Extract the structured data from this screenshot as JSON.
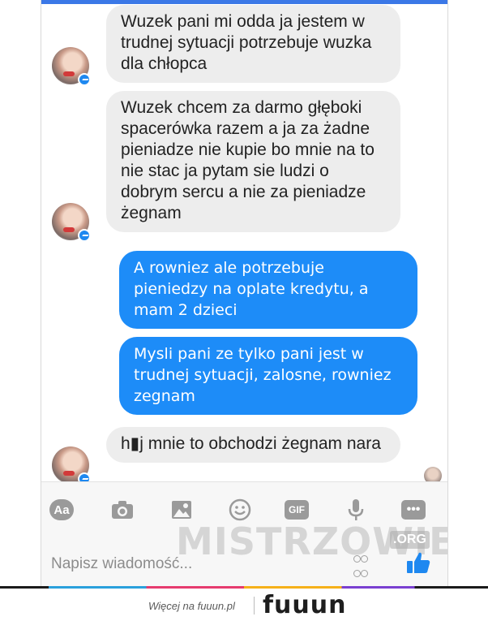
{
  "messages": [
    {
      "direction": "incoming",
      "text": "Wuzek pani mi odda ja jestem w trudnej sytuacji potrzebuje wuzka dla chłopca"
    },
    {
      "direction": "incoming",
      "text": "Wuzek chcem za darmo głęboki spacerówka razem a ja za żadne pieniadze nie kupie bo mnie na to nie stac ja pytam sie ludzi o dobrym sercu a nie za pieniadze żegnam"
    },
    {
      "direction": "outgoing",
      "text": "A rowniez ale potrzebuje pieniedzy na oplate kredytu, a mam 2 dzieci"
    },
    {
      "direction": "outgoing",
      "text": "Mysli pani ze tylko pani jest w trudnej sytuacji, zalosne, rowniez zegnam"
    },
    {
      "direction": "incoming",
      "text": "h▮j mnie to obchodzi żegnam nara"
    }
  ],
  "composer": {
    "placeholder": "Napisz wiadomość...",
    "tools": [
      "Aa",
      "camera-icon",
      "image-icon",
      "emoji-icon",
      "GIF",
      "microphone-icon",
      "more-icon"
    ],
    "aa_label": "Aa",
    "gif_label": "GIF",
    "more_label": "•••"
  },
  "watermark": {
    "text": "MISTRZOWIE",
    "suffix": ".ORG"
  },
  "footer": {
    "text": "Więcej na fuuun.pl",
    "logo": "fuuun"
  },
  "colors": {
    "incoming_bubble": "#ededed",
    "outgoing_bubble": "#1d8cf8",
    "accent": "#3b78e7",
    "like": "#1e88f0"
  }
}
